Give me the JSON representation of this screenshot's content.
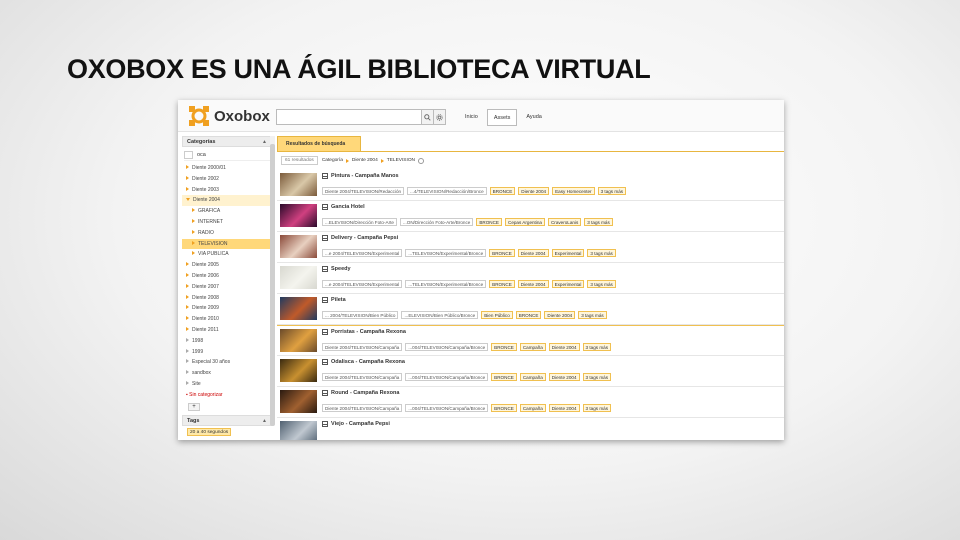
{
  "slide_title": "OXOBOX ES UNA ÁGIL BIBLIOTECA VIRTUAL",
  "app": {
    "logo_text": "Oxobox",
    "brand_color": "#f0a020",
    "search": {
      "value": "",
      "placeholder": ""
    },
    "nav": [
      {
        "label": "Inicio",
        "active": false
      },
      {
        "label": "Assets",
        "active": true
      },
      {
        "label": "Ayuda",
        "active": false
      }
    ],
    "sidebar": {
      "categories_title": "Categorías",
      "filter_value": "oca",
      "items": [
        {
          "label": "Diente 2000/01",
          "level": 0,
          "icon": "tri"
        },
        {
          "label": "Diente 2002",
          "level": 0,
          "icon": "tri"
        },
        {
          "label": "Diente 2003",
          "level": 0,
          "icon": "tri"
        },
        {
          "label": "Diente 2004",
          "level": 0,
          "icon": "tri-down",
          "state": "sel"
        },
        {
          "label": "GRAFICA",
          "level": 1,
          "icon": "tri"
        },
        {
          "label": "INTERNET",
          "level": 1,
          "icon": "tri"
        },
        {
          "label": "RADIO",
          "level": 1,
          "icon": "tri"
        },
        {
          "label": "TELEVISION",
          "level": 1,
          "icon": "tri",
          "state": "sel2"
        },
        {
          "label": "VIA PUBLICA",
          "level": 1,
          "icon": "tri"
        },
        {
          "label": "Diente 2005",
          "level": 0,
          "icon": "tri"
        },
        {
          "label": "Diente 2006",
          "level": 0,
          "icon": "tri"
        },
        {
          "label": "Diente 2007",
          "level": 0,
          "icon": "tri"
        },
        {
          "label": "Diente 2008",
          "level": 0,
          "icon": "tri"
        },
        {
          "label": "Diente 2009",
          "level": 0,
          "icon": "tri"
        },
        {
          "label": "Diente 2010",
          "level": 0,
          "icon": "tri"
        },
        {
          "label": "Diente 2011",
          "level": 0,
          "icon": "tri"
        },
        {
          "label": "1998",
          "level": 0,
          "icon": "tri-grey"
        },
        {
          "label": "1999",
          "level": 0,
          "icon": "tri-grey"
        },
        {
          "label": "Especial 30 años",
          "level": 0,
          "icon": "tri-grey"
        },
        {
          "label": "sandbox",
          "level": 0,
          "icon": "tri-grey"
        },
        {
          "label": "Site",
          "level": 0,
          "icon": "tri-grey"
        },
        {
          "label": "Sin categorizar",
          "level": 0,
          "icon": "dot-red",
          "state": "red"
        }
      ],
      "add_label": "+",
      "tags_title": "Tags",
      "tag_chips": [
        "20 a 40 segundos"
      ]
    },
    "main": {
      "tab_label": "Resultados de búsqueda",
      "count_label": "61 resultados",
      "breadcrumb": [
        "Categoría",
        "Diente 2004",
        "TELEVISION"
      ],
      "results": [
        {
          "title": "Pintura - Campaña Manos",
          "thumb": [
            "#7a5a3a",
            "#d9c8a8"
          ],
          "paths": [
            "Diente 2004/TELEVISION/Redacción",
            "...4/TELEVISION/Redacción/Bronce"
          ],
          "tags": [
            "BRONCE",
            "Diente 2004",
            "Easy Homecenter"
          ],
          "more": "3 tags más"
        },
        {
          "title": "Gancia Hotel",
          "thumb": [
            "#2a0a2a",
            "#d04080"
          ],
          "paths": [
            "...ELEVISION/Dirección Foto-Arte",
            "...ON/Dirección Foto-Arte/Bronce"
          ],
          "tags": [
            "BRONCE",
            "Cepas Argentina",
            "CraveroLanis"
          ],
          "more": "3 tags más"
        },
        {
          "title": "Delivery - Campaña Pepsi",
          "thumb": [
            "#8a4a3a",
            "#e8d0c0"
          ],
          "paths": [
            "...e 2004/TELEVISION/Experimental",
            "...TELEVISION/Experimental/Bronce"
          ],
          "tags": [
            "BRONCE",
            "Diente 2004",
            "Experimental"
          ],
          "more": "3 tags más"
        },
        {
          "title": "Speedy",
          "thumb": [
            "#d8d8d0",
            "#f4f4ee"
          ],
          "paths": [
            "...e 2004/TELEVISION/Experimental",
            "...TELEVISION/Experimental/Bronce"
          ],
          "tags": [
            "BRONCE",
            "Diente 2004",
            "Experimental"
          ],
          "more": "3 tags más"
        },
        {
          "title": "Pileta",
          "thumb": [
            "#203a60",
            "#c05a2a"
          ],
          "paths": [
            "... 2004/TELEVISION/Bien Público",
            "...ELEVISION/Bien Público/Bronce"
          ],
          "tags": [
            "Bien Público",
            "BRONCE",
            "Diente 2004"
          ],
          "more": "3 tags más"
        },
        {
          "title": "Porristas - Campaña Rexona",
          "thumb": [
            "#6a4a2a",
            "#e0a040"
          ],
          "paths": [
            "Diente 2004/TELEVISION/Campaña",
            "...004/TELEVISION/Campaña/Bronce"
          ],
          "tags": [
            "BRONCE",
            "Campaña",
            "Diente 2004"
          ],
          "more": "3 tags más"
        },
        {
          "title": "Odalisca - Campaña Rexona",
          "thumb": [
            "#3a2a10",
            "#c89030"
          ],
          "paths": [
            "Diente 2004/TELEVISION/Campaña",
            "...004/TELEVISION/Campaña/Bronce"
          ],
          "tags": [
            "BRONCE",
            "Campaña",
            "Diente 2004"
          ],
          "more": "3 tags más"
        },
        {
          "title": "Round - Campaña Rexona",
          "thumb": [
            "#2a1a10",
            "#a06030"
          ],
          "paths": [
            "Diente 2004/TELEVISION/Campaña",
            "...004/TELEVISION/Campaña/Bronce"
          ],
          "tags": [
            "BRONCE",
            "Campaña",
            "Diente 2004"
          ],
          "more": "3 tags más"
        },
        {
          "title": "Viejo - Campaña Pepsi",
          "thumb": [
            "#506070",
            "#c0c8d0"
          ],
          "paths": [
            "",
            ""
          ],
          "tags": [],
          "more": ""
        }
      ]
    }
  }
}
